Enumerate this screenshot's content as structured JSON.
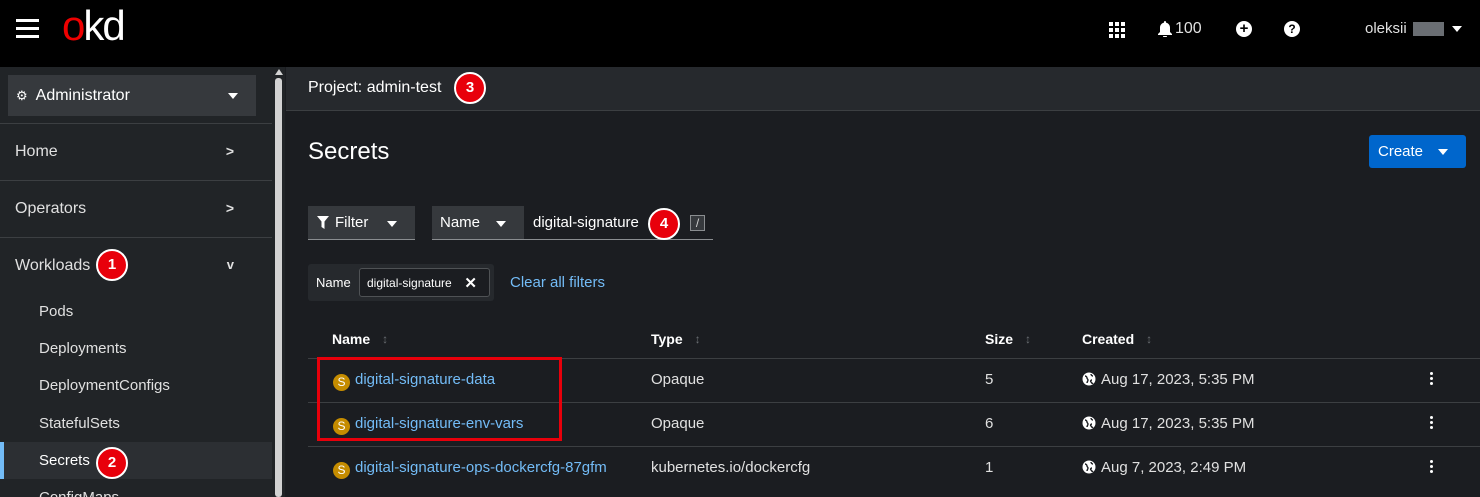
{
  "masthead": {
    "brand": "okd",
    "notification_count": "100",
    "username": "oleksii"
  },
  "sidebar": {
    "perspective": "Administrator",
    "sections": [
      {
        "label": "Home"
      },
      {
        "label": "Operators"
      },
      {
        "label": "Workloads"
      }
    ],
    "workload_items": [
      "Pods",
      "Deployments",
      "DeploymentConfigs",
      "StatefulSets",
      "Secrets",
      "ConfigMaps"
    ],
    "active_item": "Secrets"
  },
  "project_bar": {
    "label": "Project: admin-test"
  },
  "page": {
    "title": "Secrets",
    "create_label": "Create"
  },
  "filters": {
    "filter_label": "Filter",
    "name_dropdown": "Name",
    "search_value": "digital-signature",
    "shortcut_key": "/",
    "chip_group_label": "Name",
    "chip_value": "digital-signature",
    "clear_all": "Clear all filters"
  },
  "table": {
    "columns": [
      "Name",
      "Type",
      "Size",
      "Created"
    ],
    "rows": [
      {
        "badge": "S",
        "name": "digital-signature-data",
        "type": "Opaque",
        "size": "5",
        "created": "Aug 17, 2023, 5:35 PM"
      },
      {
        "badge": "S",
        "name": "digital-signature-env-vars",
        "type": "Opaque",
        "size": "6",
        "created": "Aug 17, 2023, 5:35 PM"
      },
      {
        "badge": "S",
        "name": "digital-signature-ops-dockercfg-87gfm",
        "type": "kubernetes.io/dockercfg",
        "size": "1",
        "created": "Aug 7, 2023, 2:49 PM"
      }
    ]
  },
  "annotations": [
    "1",
    "2",
    "3",
    "4"
  ],
  "colors": {
    "accent_blue": "#0066cc",
    "link": "#73bcf7",
    "annotation_red": "#e8000b",
    "badge_orange": "#c58c00"
  }
}
